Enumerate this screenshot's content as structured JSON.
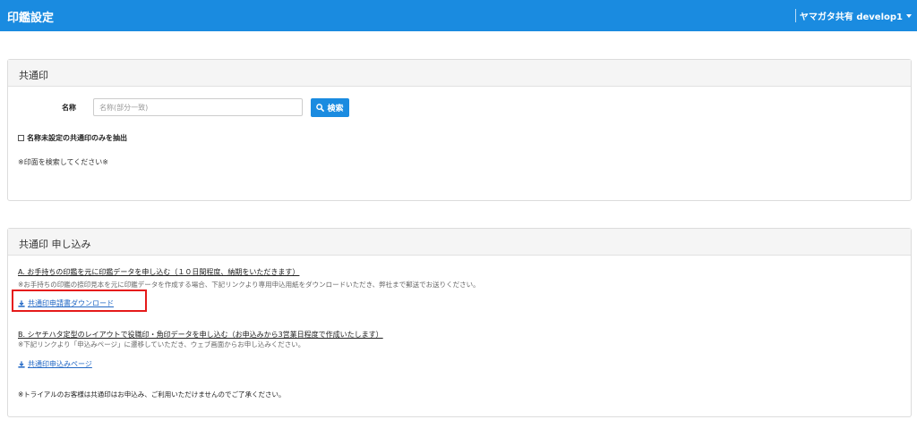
{
  "header": {
    "title": "印鑑設定",
    "user_label": "ヤマガタ共有 develop1"
  },
  "search_panel": {
    "heading": "共通印",
    "name_label": "名称",
    "name_placeholder": "名称(部分一致)",
    "search_button": "検索",
    "checkbox_label": "名称未設定の共通印のみを抽出",
    "checkbox_checked": false,
    "hint": "※印面を検索してください※"
  },
  "apply_panel": {
    "heading": "共通印 申し込み",
    "section_a_title": "A. お手持ちの印鑑を元に印鑑データを申し込む（１０日間程度、納期をいただきます）",
    "section_a_note": "※お手持ちの印鑑の捺印見本を元に印鑑データを作成する場合、下記リンクより専用申込用紙をダウンロードいただき、弊社まで郵送でお送りください。",
    "download_link": "共通印申請書ダウンロード",
    "section_b_title": "B. シヤチハタ定型のレイアウトで役職印・角印データを申し込む（お申込みから3営業日程度で作成いたします）",
    "section_b_note": "※下記リンクより「申込みページ」に遷移していただき、ウェブ画面からお申し込みください。",
    "apply_page_link": "共通印申込みページ",
    "trial_note": "※トライアルのお客様は共通印はお申込み、ご利用いただけませんのでご了承ください。"
  },
  "colors": {
    "primary": "#1a8be0",
    "link": "#2268c5",
    "highlight": "#e51a1a"
  },
  "icons": {
    "search": "search-icon",
    "download": "download-icon",
    "caret": "caret-down-icon"
  }
}
